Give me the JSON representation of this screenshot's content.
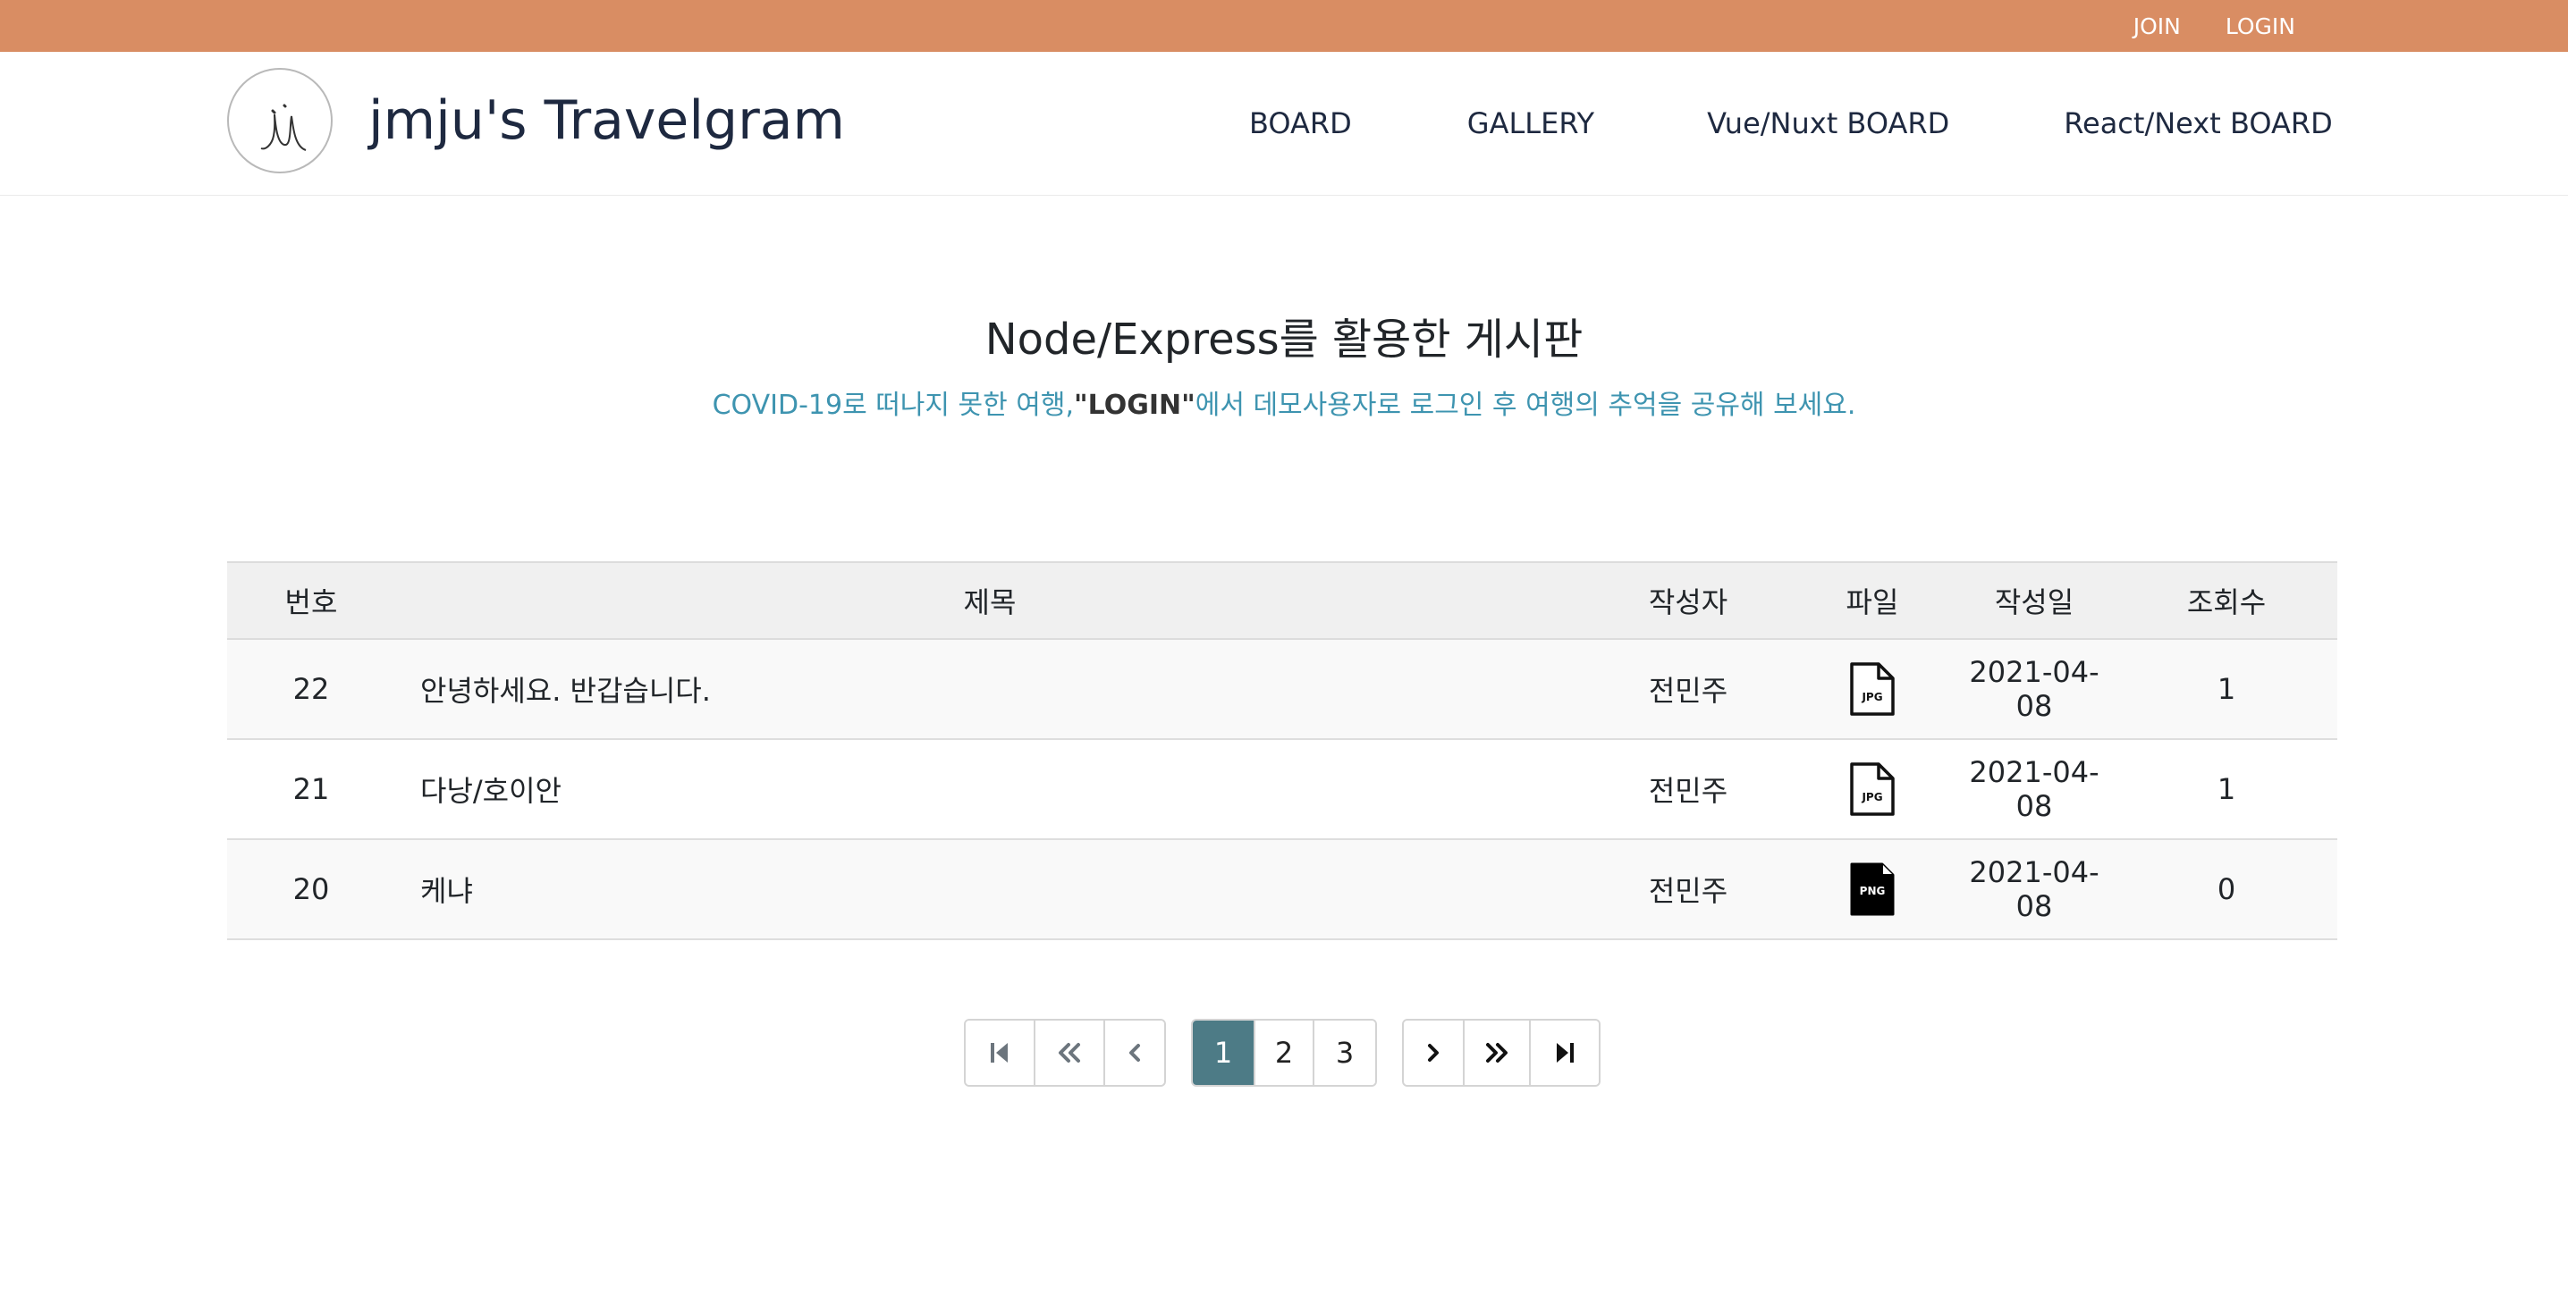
{
  "topbar": {
    "join": "JOIN",
    "login": "LOGIN"
  },
  "header": {
    "brand": "jmju's Travelgram",
    "nav": [
      {
        "label": "BOARD"
      },
      {
        "label": "GALLERY"
      },
      {
        "label": "Vue/Nuxt BOARD"
      },
      {
        "label": "React/Next BOARD"
      }
    ]
  },
  "hero": {
    "title": "Node/Express를 활용한 게시판",
    "subtitle_before": "COVID-19로 떠나지 못한 여행,",
    "subtitle_highlight": "\"LOGIN\"",
    "subtitle_after": "에서 데모사용자로 로그인 후 여행의 추억을 공유해 보세요."
  },
  "table": {
    "headers": {
      "num": "번호",
      "title": "제목",
      "author": "작성자",
      "file": "파일",
      "date": "작성일",
      "views": "조회수"
    },
    "rows": [
      {
        "num": "22",
        "title": "안녕하세요. 반갑습니다.",
        "author": "전민주",
        "file_icon": "jpg-file-icon",
        "file_label": "JPG",
        "date": "2021-04-08",
        "views": "1"
      },
      {
        "num": "21",
        "title": "다낭/호이안",
        "author": "전민주",
        "file_icon": "jpg-file-icon",
        "file_label": "JPG",
        "date": "2021-04-08",
        "views": "1"
      },
      {
        "num": "20",
        "title": "케냐",
        "author": "전민주",
        "file_icon": "png-file-icon",
        "file_label": "PNG",
        "date": "2021-04-08",
        "views": "0"
      }
    ]
  },
  "pagination": {
    "first_icon": "first-page-icon",
    "prev_block_icon": "double-chevron-left-icon",
    "prev_icon": "chevron-left-icon",
    "pages": [
      "1",
      "2",
      "3"
    ],
    "current_page": "1",
    "next_icon": "chevron-right-icon",
    "next_block_icon": "double-chevron-right-icon",
    "last_icon": "last-page-icon"
  },
  "colors": {
    "topbar": "#d98d63",
    "subtitle": "#3e94b0",
    "active_page": "#4d7b86",
    "brand_text": "#1e2940"
  }
}
